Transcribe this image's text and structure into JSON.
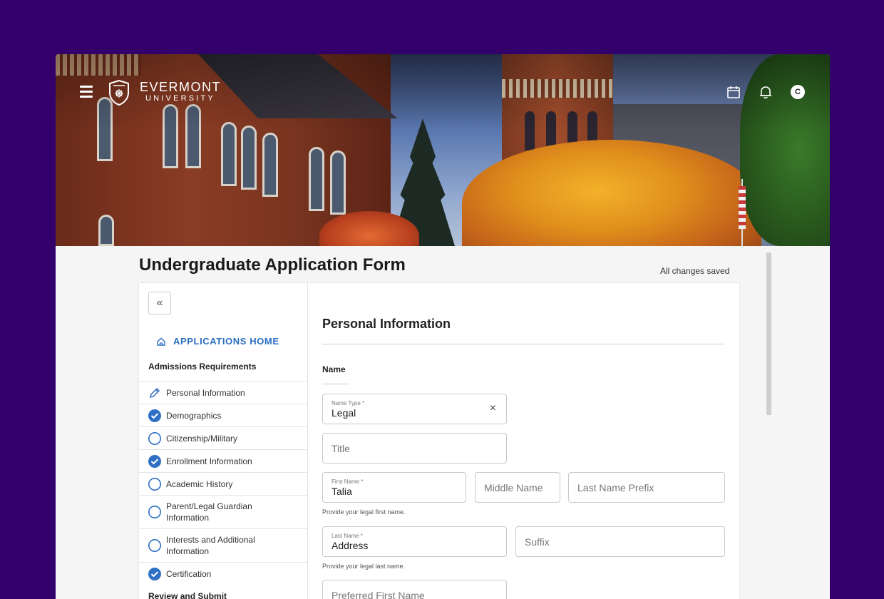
{
  "header": {
    "logo_line1": "EVERMONT",
    "logo_line2": "UNIVERSITY",
    "icons": [
      "hamburger-icon",
      "calendar-icon",
      "bell-icon"
    ],
    "avatar_initial": "C"
  },
  "page": {
    "title": "Undergraduate Application Form",
    "save_status": "All changes saved"
  },
  "sidebar": {
    "collapse_label": "«",
    "home_label": "APPLICATIONS HOME",
    "requirements_title": "Admissions Requirements",
    "steps": [
      {
        "label": "Personal Information",
        "status": "editing"
      },
      {
        "label": "Demographics",
        "status": "complete"
      },
      {
        "label": "Citizenship/Military",
        "status": "incomplete"
      },
      {
        "label": "Enrollment Information",
        "status": "complete"
      },
      {
        "label": "Academic History",
        "status": "incomplete"
      },
      {
        "label": "Parent/Legal Guardian Information",
        "status": "incomplete"
      },
      {
        "label": "Interests and Additional Information",
        "status": "incomplete"
      },
      {
        "label": "Certification",
        "status": "complete"
      }
    ],
    "review_title": "Review and Submit"
  },
  "form": {
    "section_title": "Personal  Information",
    "subsection_title": "Name",
    "name_type": {
      "label": "Name Type *",
      "value": "Legal",
      "clear": "×"
    },
    "title_field": {
      "placeholder": "Title"
    },
    "first_name": {
      "label": "First Name *",
      "value": "Talia",
      "helper": "Provide your legal first name."
    },
    "middle_name": {
      "placeholder": "Middle Name"
    },
    "last_name_prefix": {
      "placeholder": "Last Name Prefix"
    },
    "last_name": {
      "label": "Last Name *",
      "value": "Address",
      "helper": "Provide your legal last name."
    },
    "suffix": {
      "placeholder": "Suffix"
    },
    "preferred_first_name": {
      "placeholder": "Preferred First Name"
    }
  },
  "colors": {
    "background": "#33006b",
    "accent": "#2a6ec0",
    "complete": "#2f6fc4"
  }
}
